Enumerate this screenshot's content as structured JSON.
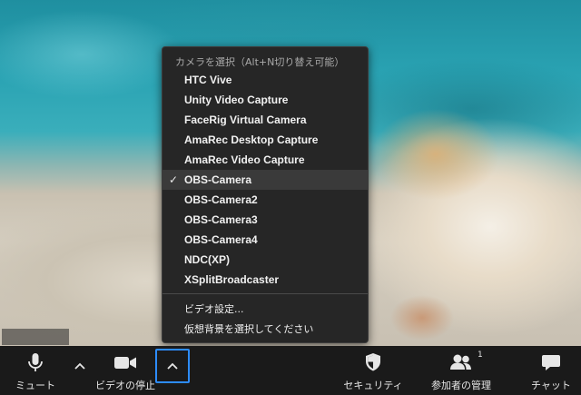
{
  "camera_menu": {
    "header": "カメラを選択（Alt+N切り替え可能）",
    "items": [
      {
        "label": "HTC Vive",
        "selected": false
      },
      {
        "label": "Unity Video Capture",
        "selected": false
      },
      {
        "label": "FaceRig Virtual Camera",
        "selected": false
      },
      {
        "label": "AmaRec Desktop Capture",
        "selected": false
      },
      {
        "label": "AmaRec Video Capture",
        "selected": false
      },
      {
        "label": "OBS-Camera",
        "selected": true
      },
      {
        "label": "OBS-Camera2",
        "selected": false
      },
      {
        "label": "OBS-Camera3",
        "selected": false
      },
      {
        "label": "OBS-Camera4",
        "selected": false
      },
      {
        "label": "NDC(XP)",
        "selected": false
      },
      {
        "label": "XSplitBroadcaster",
        "selected": false
      }
    ],
    "check_mark": "✓",
    "video_settings": "ビデオ設定...",
    "virtual_background": "仮想背景を選択してください"
  },
  "toolbar": {
    "mute_label": "ミュート",
    "stop_video_label": "ビデオの停止",
    "security_label": "セキュリティ",
    "participants_label": "参加者の管理",
    "participants_count": "1",
    "chat_label": "チャット"
  },
  "colors": {
    "toolbar_bg": "#1a1a1a",
    "menu_bg": "#262626",
    "focus_outline": "#2d8cff"
  }
}
